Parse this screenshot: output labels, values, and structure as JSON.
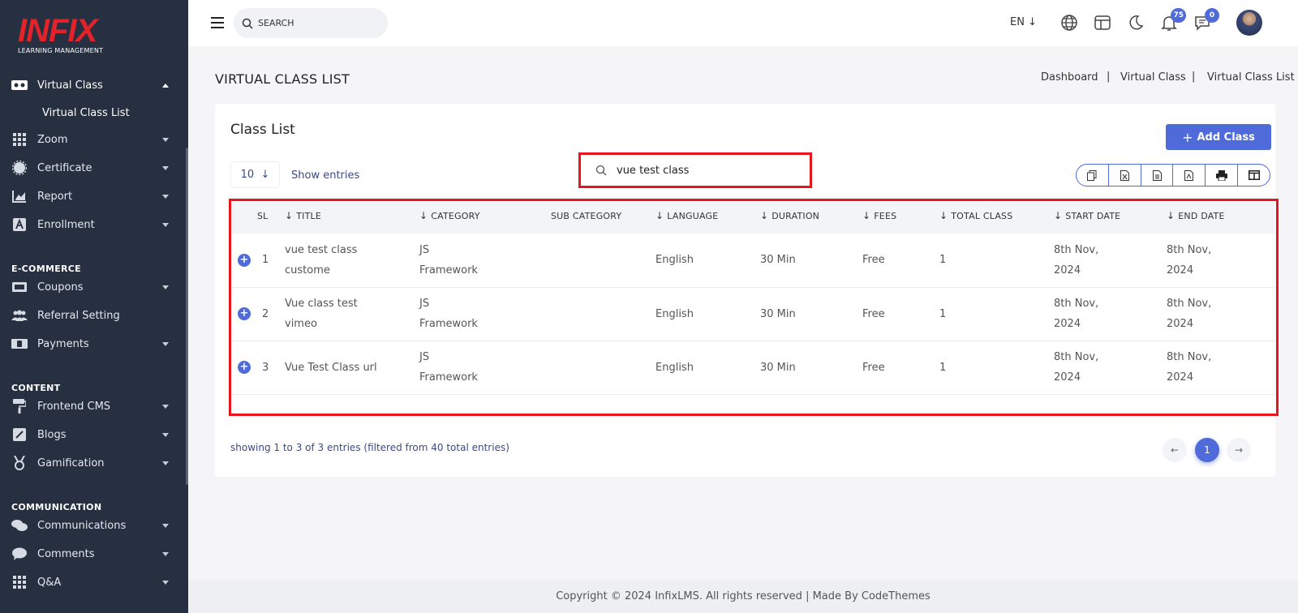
{
  "logo": {
    "main": "INFIX",
    "sub": "LEARNING MANAGEMENT"
  },
  "sidebar": {
    "active_menu": "Virtual Class",
    "active_sub": "Virtual Class List",
    "items": [
      {
        "label": "Zoom",
        "icon": "grid-icon"
      },
      {
        "label": "Certificate",
        "icon": "badge-icon"
      },
      {
        "label": "Report",
        "icon": "chart-icon"
      },
      {
        "label": "Enrollment",
        "icon": "enrollment-icon"
      }
    ],
    "sections": [
      {
        "title": "E-COMMERCE",
        "items": [
          {
            "label": "Coupons",
            "icon": "coupon-icon"
          },
          {
            "label": "Referral Setting",
            "icon": "users-icon"
          },
          {
            "label": "Payments",
            "icon": "money-icon"
          }
        ]
      },
      {
        "title": "CONTENT",
        "items": [
          {
            "label": "Frontend CMS",
            "icon": "paint-roller-icon"
          },
          {
            "label": "Blogs",
            "icon": "edit-icon"
          },
          {
            "label": "Gamification",
            "icon": "medal-icon"
          }
        ]
      },
      {
        "title": "COMMUNICATION",
        "items": [
          {
            "label": "Communications",
            "icon": "chat-icon"
          },
          {
            "label": "Comments",
            "icon": "comment-icon"
          },
          {
            "label": "Q&A",
            "icon": "grid-icon"
          }
        ]
      }
    ]
  },
  "topbar": {
    "search_placeholder": "SEARCH",
    "language": "EN",
    "notifications_count": "75",
    "messages_count": "0"
  },
  "page": {
    "title": "VIRTUAL CLASS LIST",
    "breadcrumb": [
      "Dashboard",
      "Virtual Class",
      "Virtual Class List"
    ]
  },
  "card": {
    "title": "Class List",
    "add_button": "Add Class",
    "entries_value": "10",
    "show_entries": "Show entries",
    "search_value": "vue test class",
    "export_buttons": [
      "copy-icon",
      "excel-icon",
      "csv-icon",
      "pdf-icon",
      "print-icon",
      "columns-icon"
    ]
  },
  "table": {
    "columns": [
      "SL",
      "TITLE",
      "CATEGORY",
      "SUB CATEGORY",
      "LANGUAGE",
      "DURATION",
      "FEES",
      "TOTAL CLASS",
      "START DATE",
      "END DATE"
    ],
    "rows": [
      {
        "sl": "1",
        "title": "vue test class custome",
        "category": "JS Framework",
        "sub_category": "",
        "language": "English",
        "duration": "30 Min",
        "fees": "Free",
        "total_class": "1",
        "start_date": "8th Nov, 2024",
        "end_date": "8th Nov, 2024"
      },
      {
        "sl": "2",
        "title": "Vue class test vimeo",
        "category": "JS Framework",
        "sub_category": "",
        "language": "English",
        "duration": "30 Min",
        "fees": "Free",
        "total_class": "1",
        "start_date": "8th Nov, 2024",
        "end_date": "8th Nov, 2024"
      },
      {
        "sl": "3",
        "title": "Vue Test Class url",
        "category": "JS Framework",
        "sub_category": "",
        "language": "English",
        "duration": "30 Min",
        "fees": "Free",
        "total_class": "1",
        "start_date": "8th Nov, 2024",
        "end_date": "8th Nov, 2024"
      }
    ]
  },
  "pagination": {
    "info": "showing 1 to 3 of 3 entries (filtered from 40 total entries)",
    "current": "1"
  },
  "footer": "Copyright © 2024 InfixLMS. All rights reserved | Made By CodeThemes",
  "colors": {
    "accent": "#4f6bd9",
    "sidebar": "#263040",
    "highlight": "#e8161c",
    "logo": "#e4222a"
  }
}
